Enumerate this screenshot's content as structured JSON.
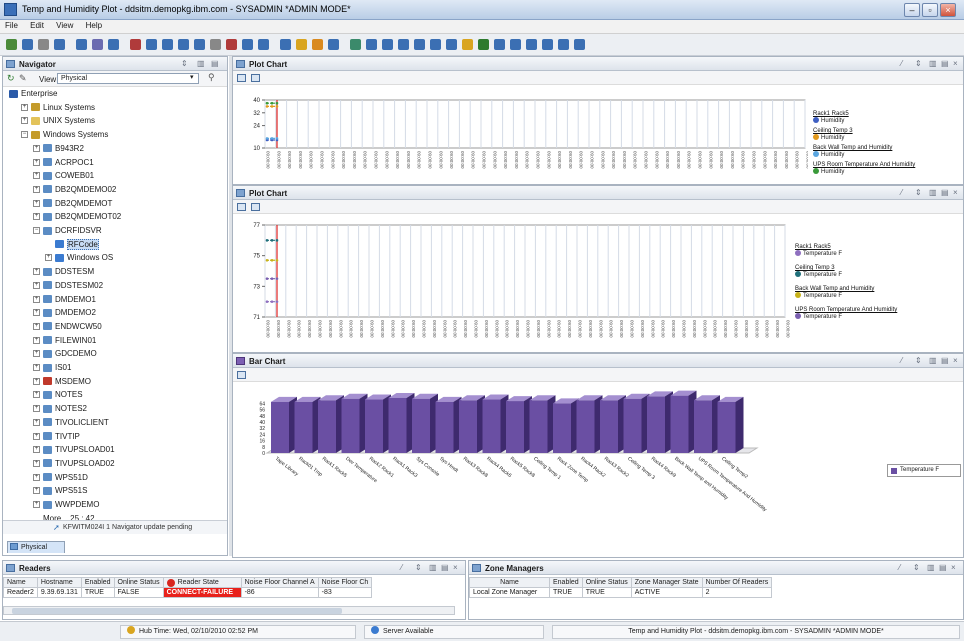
{
  "window": {
    "title": "Temp and Humidity Plot - ddsitm.demopkg.ibm.com - SYSADMIN  *ADMIN MODE*"
  },
  "menu": [
    "File",
    "Edit",
    "View",
    "Help"
  ],
  "navigator": {
    "title": "Navigator",
    "view_label": "View:",
    "view_value": "Physical",
    "tree": [
      {
        "label": "Enterprise",
        "indent": 0,
        "expander": "",
        "icon": "#2a5aa8"
      },
      {
        "label": "Linux Systems",
        "indent": 1,
        "expander": "+",
        "icon": "#c49b2a"
      },
      {
        "label": "UNIX Systems",
        "indent": 1,
        "expander": "+",
        "icon": "#e3c35a"
      },
      {
        "label": "Windows Systems",
        "indent": 1,
        "expander": "−",
        "icon": "#c49b2a"
      },
      {
        "label": "B943R2",
        "indent": 2,
        "expander": "+",
        "icon": "#5b8cc4"
      },
      {
        "label": "ACRPOC1",
        "indent": 2,
        "expander": "+",
        "icon": "#5b8cc4"
      },
      {
        "label": "COWEB01",
        "indent": 2,
        "expander": "+",
        "icon": "#5b8cc4"
      },
      {
        "label": "DB2QMDEMO02",
        "indent": 2,
        "expander": "+",
        "icon": "#5b8cc4"
      },
      {
        "label": "DB2QMDEMOT",
        "indent": 2,
        "expander": "+",
        "icon": "#5b8cc4"
      },
      {
        "label": "DB2QMDEMOT02",
        "indent": 2,
        "expander": "+",
        "icon": "#5b8cc4"
      },
      {
        "label": "DCRFIDSVR",
        "indent": 2,
        "expander": "−",
        "icon": "#5b8cc4"
      },
      {
        "label": "RFCode",
        "indent": 3,
        "expander": "",
        "icon": "#3b7bd0",
        "selected": true
      },
      {
        "label": "Windows OS",
        "indent": 3,
        "expander": "+",
        "icon": "#3b7bd0"
      },
      {
        "label": "DDSTESM",
        "indent": 2,
        "expander": "+",
        "icon": "#5b8cc4"
      },
      {
        "label": "DDSTESM02",
        "indent": 2,
        "expander": "+",
        "icon": "#5b8cc4"
      },
      {
        "label": "DMDEMO1",
        "indent": 2,
        "expander": "+",
        "icon": "#5b8cc4"
      },
      {
        "label": "DMDEMO2",
        "indent": 2,
        "expander": "+",
        "icon": "#5b8cc4"
      },
      {
        "label": "ENDWCW50",
        "indent": 2,
        "expander": "+",
        "icon": "#5b8cc4"
      },
      {
        "label": "FILEWIN01",
        "indent": 2,
        "expander": "+",
        "icon": "#5b8cc4"
      },
      {
        "label": "GDCDEMO",
        "indent": 2,
        "expander": "+",
        "icon": "#5b8cc4"
      },
      {
        "label": "IS01",
        "indent": 2,
        "expander": "+",
        "icon": "#5b8cc4"
      },
      {
        "label": "MSDEMO",
        "indent": 2,
        "expander": "+",
        "icon": "#c0392b"
      },
      {
        "label": "NOTES",
        "indent": 2,
        "expander": "+",
        "icon": "#5b8cc4"
      },
      {
        "label": "NOTES2",
        "indent": 2,
        "expander": "+",
        "icon": "#5b8cc4"
      },
      {
        "label": "TIVOLICLIENT",
        "indent": 2,
        "expander": "+",
        "icon": "#5b8cc4"
      },
      {
        "label": "TIVTIP",
        "indent": 2,
        "expander": "+",
        "icon": "#5b8cc4"
      },
      {
        "label": "TIVUPSLOAD01",
        "indent": 2,
        "expander": "+",
        "icon": "#5b8cc4"
      },
      {
        "label": "TIVUPSLOAD02",
        "indent": 2,
        "expander": "+",
        "icon": "#5b8cc4"
      },
      {
        "label": "WPS51D",
        "indent": 2,
        "expander": "+",
        "icon": "#5b8cc4"
      },
      {
        "label": "WPS51S",
        "indent": 2,
        "expander": "+",
        "icon": "#5b8cc4"
      },
      {
        "label": "WWPDEMO",
        "indent": 2,
        "expander": "+",
        "icon": "#5b8cc4"
      },
      {
        "label": "More... 25 : 42",
        "indent": 2,
        "expander": "",
        "icon": ""
      }
    ],
    "status": "KFWITM024I 1 Navigator update pending",
    "tab": "Physical"
  },
  "plot1": {
    "title": "Plot Chart",
    "legend": [
      {
        "name": "Rack1 Rack5",
        "attr": "Humidity",
        "color": "#3f5fc2"
      },
      {
        "name": "Ceiling Temp 3",
        "attr": "Humidity",
        "color": "#e39a1c"
      },
      {
        "name": "Back Wall Temp and Humidity",
        "attr": "Humidity",
        "color": "#5aa6e0"
      },
      {
        "name": "UPS Room Temperature And Humidity",
        "attr": "Humidity",
        "color": "#3a9a3a"
      }
    ]
  },
  "plot2": {
    "title": "Plot Chart",
    "legend": [
      {
        "name": "Rack1 Rack5",
        "attr": "Temperature F",
        "color": "#8e6fbf"
      },
      {
        "name": "Ceiling Temp 3",
        "attr": "Temperature F",
        "color": "#1f6f7a"
      },
      {
        "name": "Back Wall Temp and Humidity",
        "attr": "Temperature F",
        "color": "#c7b21a"
      },
      {
        "name": "UPS Room Temperature And Humidity",
        "attr": "Temperature F",
        "color": "#7a5fb0"
      }
    ]
  },
  "bar": {
    "title": "Bar Chart",
    "legend": "Temperature F"
  },
  "chart_data": [
    {
      "type": "line",
      "title": "Plot Chart",
      "ylim": [
        10,
        40
      ],
      "yticks": [
        10,
        24,
        32,
        40
      ],
      "series": [
        {
          "name": "Rack1 Rack5 Humidity",
          "values": [
            15,
            15,
            15
          ]
        },
        {
          "name": "Ceiling Temp 3 Humidity",
          "values": [
            36,
            36,
            36
          ]
        },
        {
          "name": "Back Wall Temp and Humidity Humidity",
          "values": [
            16,
            16,
            16
          ]
        },
        {
          "name": "UPS Room Temperature And Humidity Humidity",
          "values": [
            38,
            38,
            38
          ]
        }
      ]
    },
    {
      "type": "line",
      "title": "Plot Chart",
      "ylim": [
        71,
        77
      ],
      "yticks": [
        71,
        73,
        75,
        77
      ],
      "series": [
        {
          "name": "Rack1 Rack5 Temperature F",
          "values": [
            72,
            72,
            72
          ]
        },
        {
          "name": "Ceiling Temp 3 Temperature F",
          "values": [
            76,
            76,
            76
          ]
        },
        {
          "name": "Back Wall Temp and Humidity Temperature F",
          "values": [
            74.7,
            74.7,
            74.7
          ]
        },
        {
          "name": "UPS Room Temperature And Humidity Temperature F",
          "values": [
            73.5,
            73.5,
            73.5
          ]
        }
      ]
    },
    {
      "type": "bar",
      "title": "Bar Chart",
      "categories": [
        "Tape Library",
        "Rack01 Tmp",
        "Rack1 Rack5",
        "Dev Temperature",
        "Rack2 Rack1",
        "Rack1 Rack3",
        "Sys Console",
        "Sys Hmdt",
        "Rack3 Rack8",
        "Rack4 Rack6",
        "Rack5 Rack8",
        "Ceiling Temp 1",
        "Rack Zone Temp",
        "Rack4 Rack2",
        "Rack3 Rack2",
        "Ceiling Temp 3",
        "Rack4 Rack9",
        "Back Wall Temp and Humidity",
        "UPS Room Temperature And Humidity",
        "Ceiling Temp2"
      ],
      "values": [
        66,
        66,
        68,
        70,
        69,
        71,
        70,
        66,
        68,
        69,
        67,
        68,
        64,
        68,
        68,
        70,
        73,
        74,
        68,
        66
      ],
      "ylim": [
        0,
        80
      ],
      "yticks": [
        0,
        8,
        16,
        24,
        32,
        40,
        48,
        56,
        64
      ],
      "series": [
        {
          "name": "Temperature F"
        }
      ]
    }
  ],
  "readers": {
    "title": "Readers",
    "columns": [
      "Name",
      "Hostname",
      "Enabled",
      "Online Status",
      "Reader State",
      "Noise Floor Channel A",
      "Noise Floor Ch"
    ],
    "rows": [
      [
        "Reader2",
        "9.39.69.131",
        "TRUE",
        "FALSE",
        "CONNECT-FAILURE",
        "-86",
        "-83"
      ]
    ]
  },
  "zones": {
    "title": "Zone Managers",
    "columns": [
      "Name",
      "Enabled",
      "Online Status",
      "Zone Manager State",
      "Number Of Readers"
    ],
    "rows": [
      [
        "Local Zone Manager",
        "TRUE",
        "TRUE",
        "ACTIVE",
        "2"
      ]
    ]
  },
  "status": {
    "hub_time": "Hub Time: Wed, 02/10/2010 02:52 PM",
    "server": "Server Available",
    "context": "Temp and Humidity Plot - ddsitm.demopkg.ibm.com - SYSADMIN  *ADMIN MODE*"
  }
}
